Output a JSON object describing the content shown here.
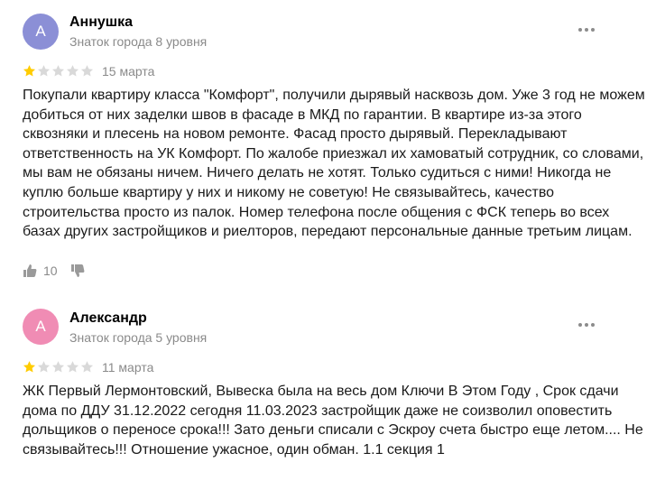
{
  "reviews": [
    {
      "avatar_letter": "А",
      "avatar_color": "#8b8fd6",
      "author": "Аннушка",
      "level": "Знаток города 8 уровня",
      "rating": 1,
      "date": "15 марта",
      "text": "Покупали квартиру класса \"Комфорт\", получили дырявый насквозь дом. Уже 3 год не можем добиться от них заделки швов в фасаде в МКД по гарантии. В квартире из-за этого сквозняки и плесень на новом ремонте. Фасад просто дырявый. Перекладывают ответственность на УК Комфорт. По жалобе приезжал их хамоватый сотрудник, со словами, мы вам не обязаны ничем. Ничего делать не хотят. Только судиться с ними! Никогда не куплю больше квартиру у них и никому не советую! Не связывайтесь, качество строительства просто из палок. Номер телефона после общения с ФСК теперь во всех базах других застройщиков и риелторов, передают персональные данные третьим лицам.",
      "likes": "10"
    },
    {
      "avatar_letter": "А",
      "avatar_color": "#f08cb4",
      "author": "Александр",
      "level": "Знаток города 5 уровня",
      "rating": 1,
      "date": "11 марта",
      "text": "ЖК Первый Лермонтовский, Вывеска была на весь дом Ключи В Этом Году , Срок сдачи дома по ДДУ 31.12.2022 сегодня 11.03.2023 застройщик даже не соизволил оповестить дольщиков о переносе срока!!! Зато деньги списали с Эскроу счета быстро еще летом.... Не связывайтесь!!! Отношение ужасное, один обман. 1.1 секция 1"
    }
  ],
  "icons": {
    "star_filled_color": "#fc0",
    "star_empty_color": "#d9d9d9",
    "menu": "more-dots-icon",
    "like": "thumb-up-icon",
    "dislike": "thumb-down-icon"
  }
}
